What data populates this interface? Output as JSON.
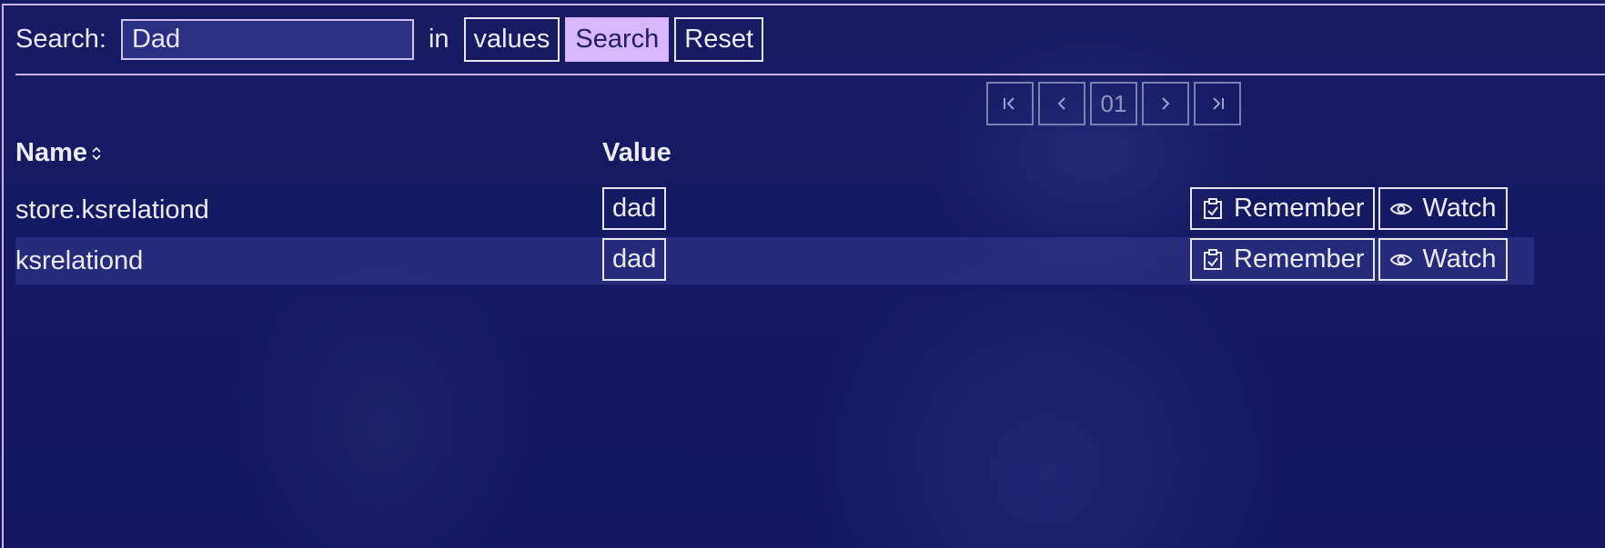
{
  "search": {
    "label": "Search:",
    "value": "Dad",
    "in_label": "in",
    "scope_button": "values",
    "search_button": "Search",
    "reset_button": "Reset"
  },
  "pagination": {
    "page": "01",
    "icons": [
      "first-page-icon",
      "prev-page-icon",
      "next-page-icon",
      "last-page-icon"
    ]
  },
  "table": {
    "columns": {
      "name": "Name",
      "value": "Value"
    },
    "rows": [
      {
        "name": "store.ksrelationd",
        "value": "dad",
        "remember": "Remember",
        "watch": "Watch"
      },
      {
        "name": "ksrelationd",
        "value": "dad",
        "remember": "Remember",
        "watch": "Watch"
      }
    ]
  },
  "colors": {
    "background": "#14195e",
    "accent": "#d8b7ff",
    "border": "#c9b6f5"
  }
}
